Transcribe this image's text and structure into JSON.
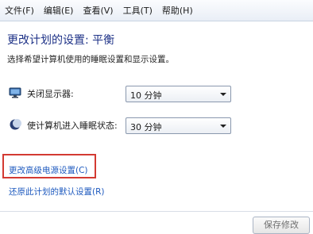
{
  "menubar": {
    "items": [
      "文件(F)",
      "编辑(E)",
      "查看(V)",
      "工具(T)",
      "帮助(H)"
    ]
  },
  "header": {
    "title": "更改计划的设置: 平衡",
    "description": "选择希望计算机使用的睡眠设置和显示设置。"
  },
  "settings": {
    "display": {
      "icon": "monitor-icon",
      "label": "关闭显示器:",
      "value": "10 分钟"
    },
    "sleep": {
      "icon": "moon-icon",
      "label": "使计算机进入睡眠状态:",
      "value": "30 分钟"
    }
  },
  "links": {
    "advanced": "更改高级电源设置(C)",
    "restore": "还原此计划的默认设置(R)"
  },
  "footer": {
    "save_label": "保存修改"
  },
  "colors": {
    "title": "#1e3287",
    "link": "#1e5abf",
    "highlight": "#d33a32"
  }
}
